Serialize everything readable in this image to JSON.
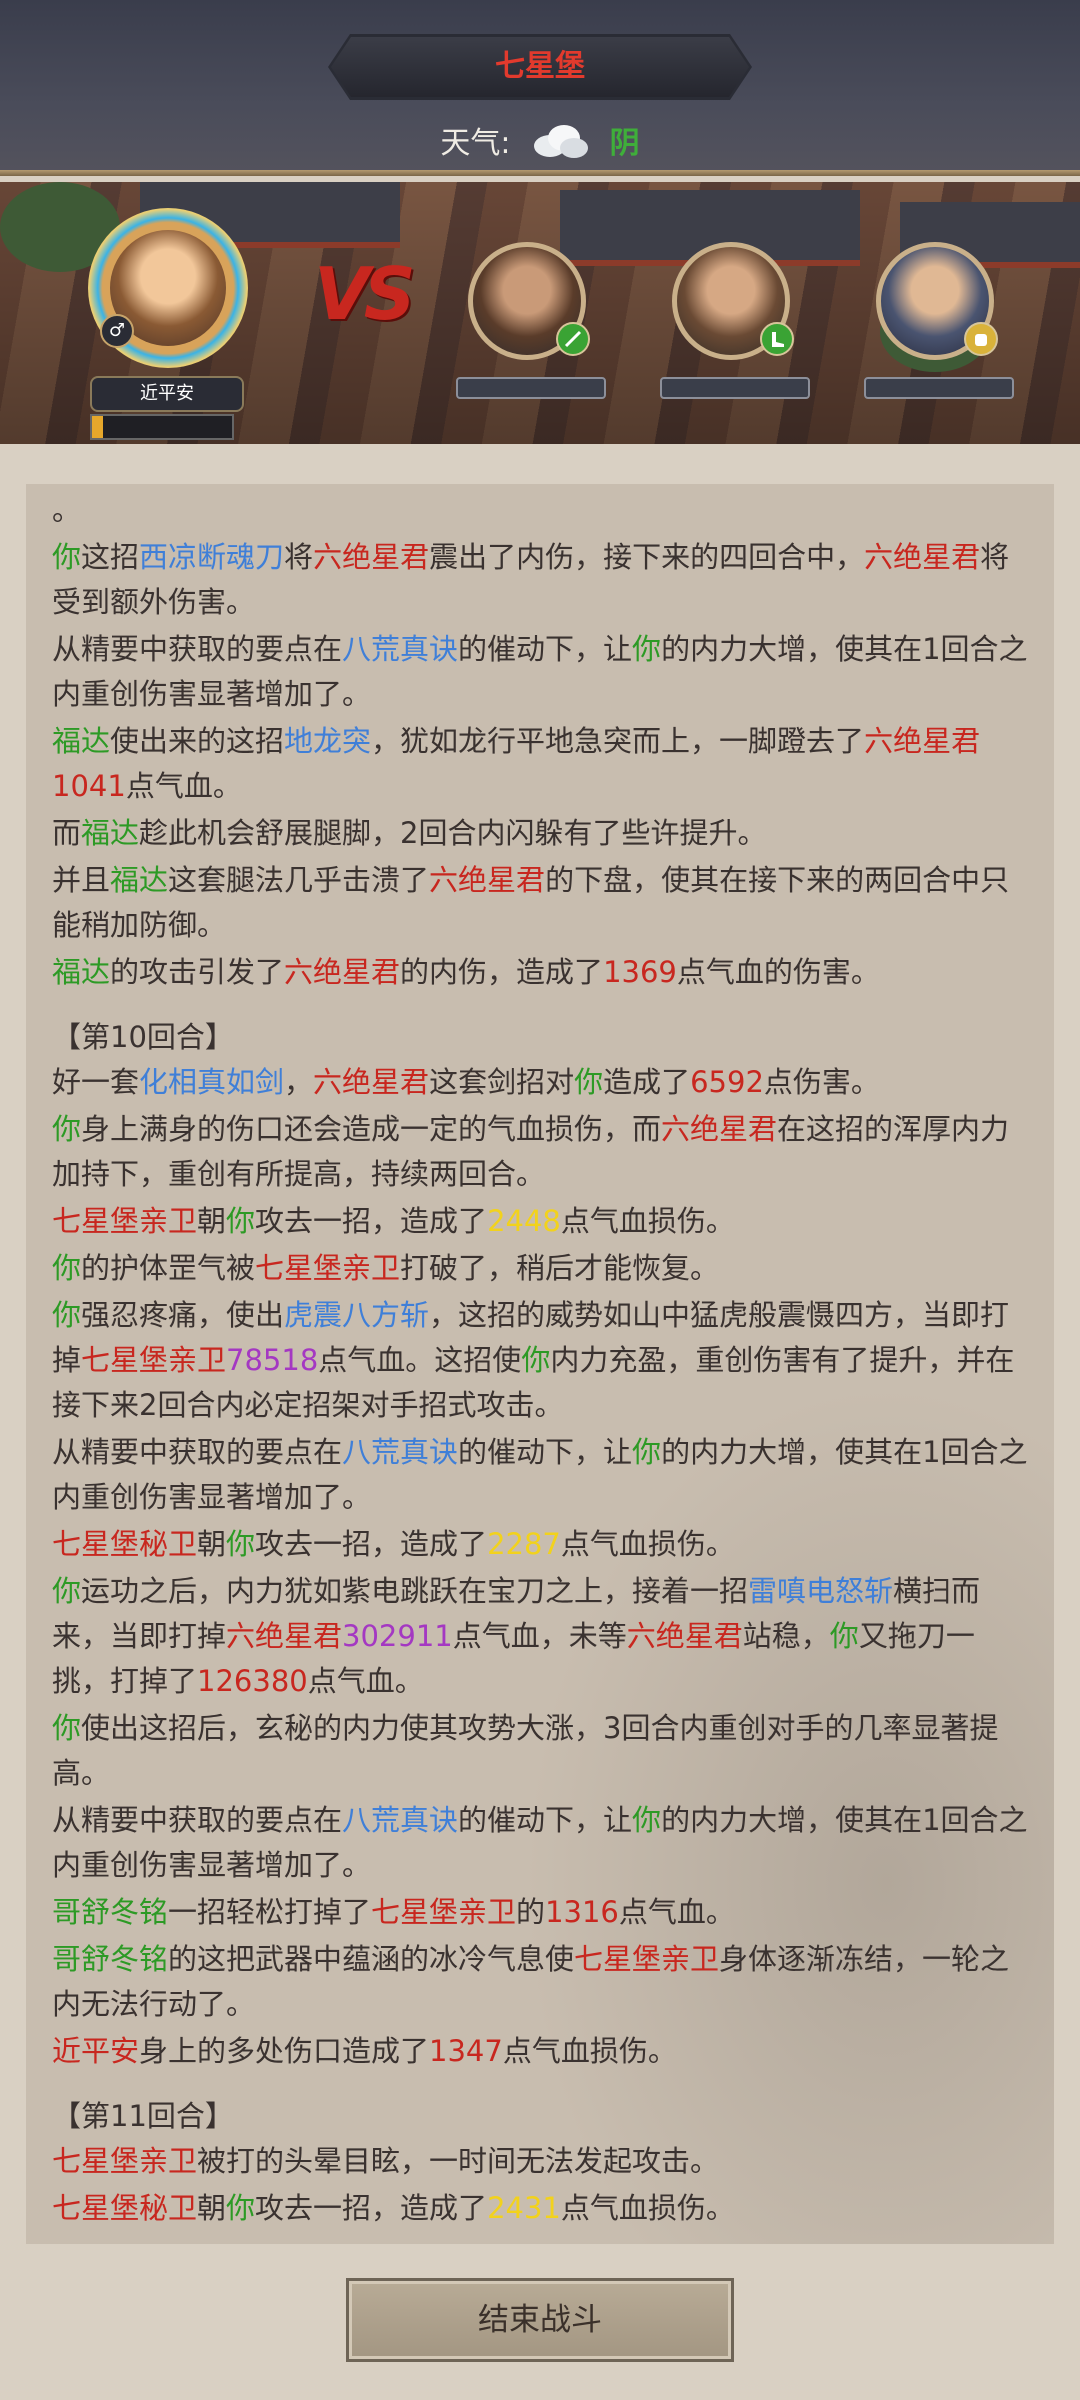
{
  "header": {
    "location": "七星堡",
    "weather_label": "天气:",
    "weather_value": "阴"
  },
  "player": {
    "name": "近平安",
    "gender": "♂",
    "hp_fraction": 0.08
  },
  "enemies": [
    {
      "badge_color": "#3aa334"
    },
    {
      "badge_color": "#3aa334"
    },
    {
      "badge_color": "#d9b23a"
    }
  ],
  "log": [
    [
      {
        "t": "。"
      }
    ],
    [
      {
        "t": "你",
        "c": "g"
      },
      {
        "t": "这招"
      },
      {
        "t": "西凉断魂刀",
        "c": "b"
      },
      {
        "t": "将"
      },
      {
        "t": "六绝星君",
        "c": "r"
      },
      {
        "t": "震出了内伤，接下来的四回合中，"
      },
      {
        "t": "六绝星君",
        "c": "r"
      },
      {
        "t": "将受到额外伤害。"
      }
    ],
    [
      {
        "t": "从精要中获取的要点在"
      },
      {
        "t": "八荒真诀",
        "c": "b"
      },
      {
        "t": "的催动下，让"
      },
      {
        "t": "你",
        "c": "g"
      },
      {
        "t": "的内力大增，使其在1回合之内重创伤害显著增加了。"
      }
    ],
    [
      {
        "t": "福达",
        "c": "g"
      },
      {
        "t": "使出来的这招"
      },
      {
        "t": "地龙突",
        "c": "b"
      },
      {
        "t": "，犹如龙行平地急突而上，一脚蹬去了"
      },
      {
        "t": "六绝星君",
        "c": "r"
      },
      {
        "t": "1041",
        "c": "r"
      },
      {
        "t": "点气血。"
      }
    ],
    [
      {
        "t": "而"
      },
      {
        "t": "福达",
        "c": "g"
      },
      {
        "t": "趁此机会舒展腿脚，2回合内闪躲有了些许提升。"
      }
    ],
    [
      {
        "t": "并且"
      },
      {
        "t": "福达",
        "c": "g"
      },
      {
        "t": "这套腿法几乎击溃了"
      },
      {
        "t": "六绝星君",
        "c": "r"
      },
      {
        "t": "的下盘，使其在接下来的两回合中只能稍加防御。"
      }
    ],
    [
      {
        "t": "福达",
        "c": "g"
      },
      {
        "t": "的攻击引发了"
      },
      {
        "t": "六绝星君",
        "c": "r"
      },
      {
        "t": "的内伤，造成了"
      },
      {
        "t": "1369",
        "c": "r"
      },
      {
        "t": "点气血的伤害。"
      }
    ],
    {
      "round": "【第10回合】"
    },
    [
      {
        "t": "好一套"
      },
      {
        "t": "化相真如剑",
        "c": "b"
      },
      {
        "t": "，"
      },
      {
        "t": "六绝星君",
        "c": "r"
      },
      {
        "t": "这套剑招对"
      },
      {
        "t": "你",
        "c": "g"
      },
      {
        "t": "造成了"
      },
      {
        "t": "6592",
        "c": "r"
      },
      {
        "t": "点伤害。"
      }
    ],
    [
      {
        "t": "你",
        "c": "g"
      },
      {
        "t": "身上满身的伤口还会造成一定的气血损伤，而"
      },
      {
        "t": "六绝星君",
        "c": "r"
      },
      {
        "t": "在这招的浑厚内力加持下，重创有所提高，持续两回合。"
      }
    ],
    [
      {
        "t": "七星堡亲卫",
        "c": "r"
      },
      {
        "t": "朝"
      },
      {
        "t": "你",
        "c": "g"
      },
      {
        "t": "攻去一招，造成了"
      },
      {
        "t": "2448",
        "c": "y"
      },
      {
        "t": "点气血损伤。"
      }
    ],
    [
      {
        "t": "你",
        "c": "g"
      },
      {
        "t": "的护体罡气被"
      },
      {
        "t": "七星堡亲卫",
        "c": "r"
      },
      {
        "t": "打破了，稍后才能恢复。"
      }
    ],
    [
      {
        "t": "你",
        "c": "g"
      },
      {
        "t": "强忍疼痛，使出"
      },
      {
        "t": "虎震八方斩",
        "c": "b"
      },
      {
        "t": "，这招的威势如山中猛虎般震慑四方，当即打掉"
      },
      {
        "t": "七星堡亲卫",
        "c": "r"
      },
      {
        "t": "78518",
        "c": "p"
      },
      {
        "t": "点气血。这招使"
      },
      {
        "t": "你",
        "c": "g"
      },
      {
        "t": "内力充盈，重创伤害有了提升，并在接下来2回合内必定招架对手招式攻击。"
      }
    ],
    [
      {
        "t": "从精要中获取的要点在"
      },
      {
        "t": "八荒真诀",
        "c": "b"
      },
      {
        "t": "的催动下，让"
      },
      {
        "t": "你",
        "c": "g"
      },
      {
        "t": "的内力大增，使其在1回合之内重创伤害显著增加了。"
      }
    ],
    [
      {
        "t": "七星堡秘卫",
        "c": "r"
      },
      {
        "t": "朝"
      },
      {
        "t": "你",
        "c": "g"
      },
      {
        "t": "攻去一招，造成了"
      },
      {
        "t": "2287",
        "c": "y"
      },
      {
        "t": "点气血损伤。"
      }
    ],
    [
      {
        "t": "你",
        "c": "g"
      },
      {
        "t": "运功之后，内力犹如紫电跳跃在宝刀之上，接着一招"
      },
      {
        "t": "雷嗔电怒斩",
        "c": "b"
      },
      {
        "t": "横扫而来，当即打掉"
      },
      {
        "t": "六绝星君",
        "c": "r"
      },
      {
        "t": "302911",
        "c": "p"
      },
      {
        "t": "点气血，未等"
      },
      {
        "t": "六绝星君",
        "c": "r"
      },
      {
        "t": "站稳，"
      },
      {
        "t": "你",
        "c": "g"
      },
      {
        "t": "又拖刀一挑，打掉了"
      },
      {
        "t": "126380",
        "c": "r"
      },
      {
        "t": "点气血。"
      }
    ],
    [
      {
        "t": "你",
        "c": "g"
      },
      {
        "t": "使出这招后，玄秘的内力使其攻势大涨，3回合内重创对手的几率显著提高。"
      }
    ],
    [
      {
        "t": "从精要中获取的要点在"
      },
      {
        "t": "八荒真诀",
        "c": "b"
      },
      {
        "t": "的催动下，让"
      },
      {
        "t": "你",
        "c": "g"
      },
      {
        "t": "的内力大增，使其在1回合之内重创伤害显著增加了。"
      }
    ],
    [
      {
        "t": "哥舒冬铭",
        "c": "g"
      },
      {
        "t": "一招轻松打掉了"
      },
      {
        "t": "七星堡亲卫",
        "c": "r"
      },
      {
        "t": "的"
      },
      {
        "t": "1316",
        "c": "r"
      },
      {
        "t": "点气血。"
      }
    ],
    [
      {
        "t": "哥舒冬铭",
        "c": "g"
      },
      {
        "t": "的这把武器中蕴涵的冰冷气息使"
      },
      {
        "t": "七星堡亲卫",
        "c": "r"
      },
      {
        "t": "身体逐渐冻结，一轮之内无法行动了。"
      }
    ],
    [
      {
        "t": "近平安",
        "c": "r"
      },
      {
        "t": "身上的多处伤口造成了"
      },
      {
        "t": "1347",
        "c": "r"
      },
      {
        "t": "点气血损伤。"
      }
    ],
    {
      "round": "【第11回合】"
    },
    [
      {
        "t": "七星堡亲卫",
        "c": "r"
      },
      {
        "t": "被打的头晕目眩，一时间无法发起攻击。"
      }
    ],
    [
      {
        "t": "七星堡秘卫",
        "c": "r"
      },
      {
        "t": "朝"
      },
      {
        "t": "你",
        "c": "g"
      },
      {
        "t": "攻去一招，造成了"
      },
      {
        "t": "2431",
        "c": "y"
      },
      {
        "t": "点气血损伤。"
      }
    ]
  ],
  "footer": {
    "end_button": "结束战斗"
  }
}
